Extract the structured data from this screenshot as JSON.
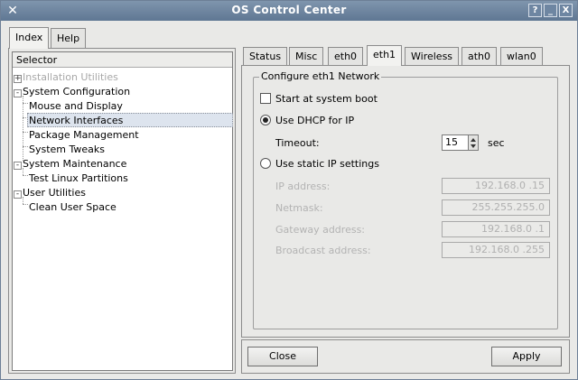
{
  "window": {
    "title": "OS Control Center",
    "controls": [
      "?",
      "_",
      "X"
    ]
  },
  "left_tabs": [
    {
      "label": "Index",
      "active": true
    },
    {
      "label": "Help",
      "active": false
    }
  ],
  "selector": {
    "header": "Selector",
    "items": [
      {
        "label": "Installation Utilities",
        "expander": "+",
        "disabled": true
      },
      {
        "label": "System Configuration",
        "expander": "-"
      },
      {
        "label": "Mouse and Display"
      },
      {
        "label": "Network Interfaces",
        "selected": true
      },
      {
        "label": "Package Management"
      },
      {
        "label": "System Tweaks"
      },
      {
        "label": "System Maintenance",
        "expander": "-"
      },
      {
        "label": "Test Linux Partitions"
      },
      {
        "label": "User Utilities",
        "expander": "-"
      },
      {
        "label": "Clean User Space"
      }
    ]
  },
  "right_tabs": [
    {
      "label": "Status"
    },
    {
      "label": "Misc"
    },
    {
      "label": "eth0"
    },
    {
      "label": "eth1",
      "active": true
    },
    {
      "label": "Wireless"
    },
    {
      "label": "ath0"
    },
    {
      "label": "wlan0"
    }
  ],
  "config": {
    "group_title": "Configure eth1 Network",
    "start_at_boot": {
      "label": "Start at system boot",
      "checked": false
    },
    "dhcp": {
      "label": "Use DHCP for IP",
      "selected": true
    },
    "timeout": {
      "label": "Timeout:",
      "value": "15",
      "unit": "sec"
    },
    "static": {
      "label": "Use static IP settings",
      "selected": false
    },
    "fields": [
      {
        "label": "IP address:",
        "value": "192.168.0 .15"
      },
      {
        "label": "Netmask:",
        "value": "255.255.255.0"
      },
      {
        "label": "Gateway address:",
        "value": "192.168.0 .1"
      },
      {
        "label": "Broadcast address:",
        "value": "192.168.0 .255"
      }
    ]
  },
  "buttons": {
    "close": "Close",
    "apply": "Apply"
  }
}
